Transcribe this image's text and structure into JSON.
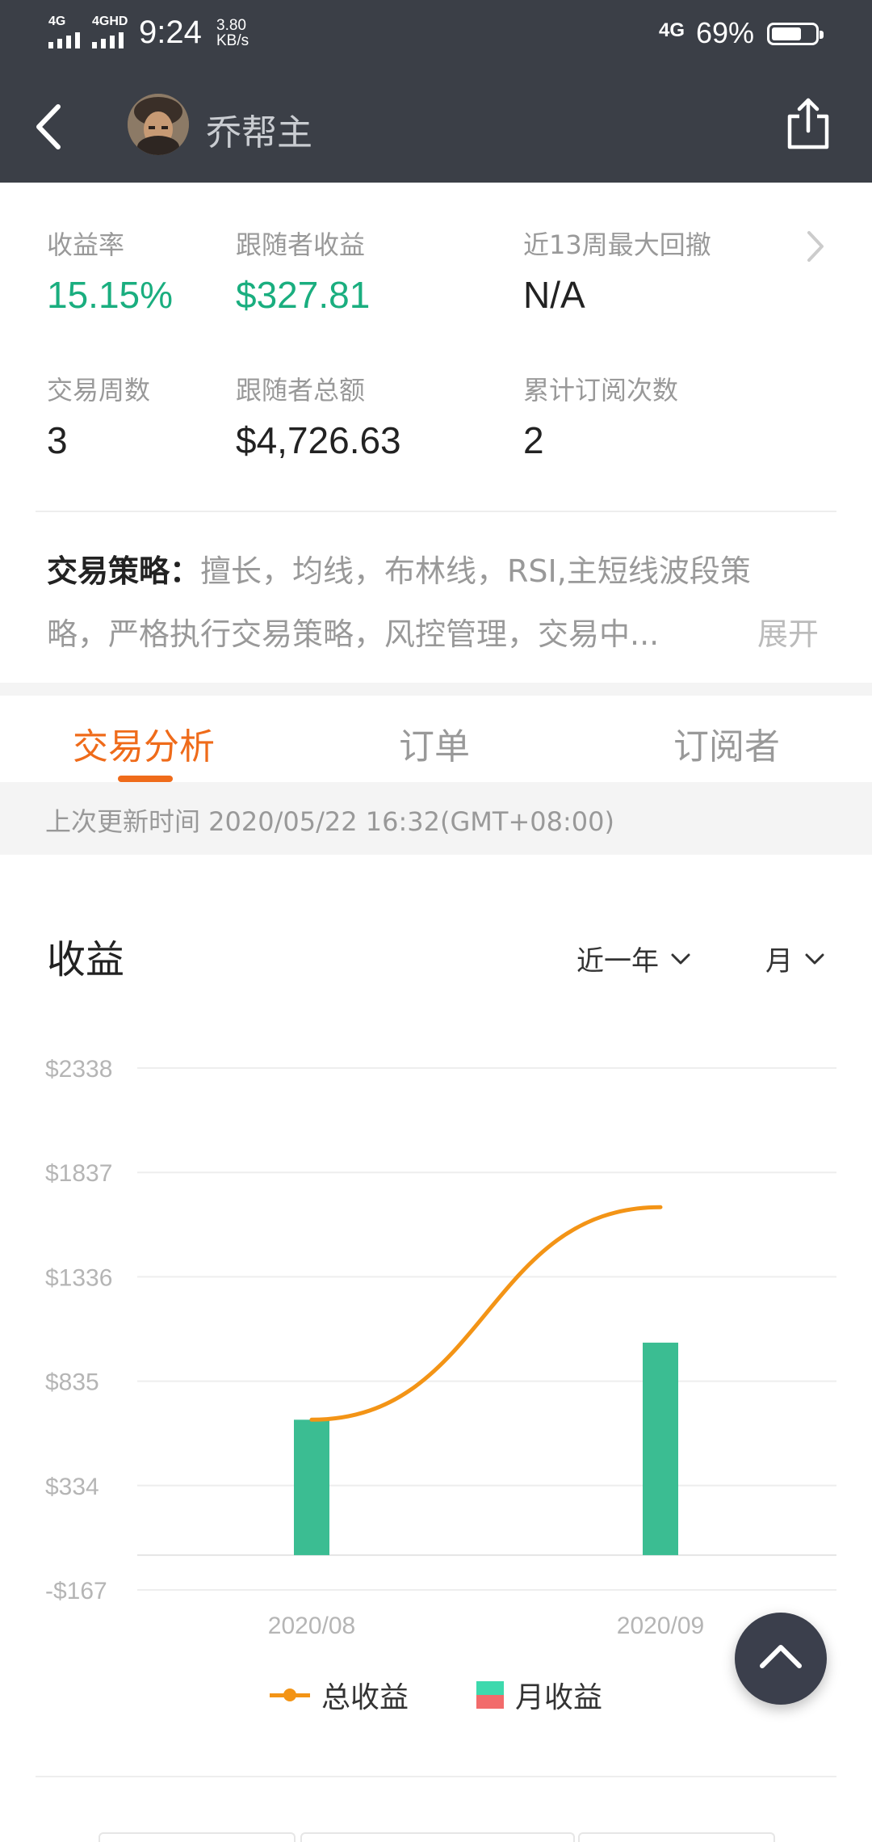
{
  "status_bar": {
    "signal1": "4G",
    "signal2": "4GHD",
    "time": "9:24",
    "speed_value": "3.80",
    "speed_unit": "KB/s",
    "network": "4G",
    "battery": "69%",
    "battery_level": 0.69
  },
  "nav": {
    "title": "乔帮主",
    "back_icon": "chevron-left-icon",
    "share_icon": "share-icon"
  },
  "stats": [
    {
      "label": "收益率",
      "value": "15.15%",
      "color": "#1aae7f"
    },
    {
      "label": "跟随者收益",
      "value": "$327.81",
      "color": "#1aae7f"
    },
    {
      "label": "近13周最大回撤",
      "value": "N/A",
      "color": "#222222"
    },
    {
      "label": "交易周数",
      "value": "3",
      "color": "#222222"
    },
    {
      "label": "跟随者总额",
      "value": "$4,726.63",
      "color": "#222222"
    },
    {
      "label": "累计订阅次数",
      "value": "2",
      "color": "#222222"
    }
  ],
  "strategy": {
    "label": "交易策略：",
    "text_line1": "擅长，均线，布林线，RSI,主短线波段策",
    "text_line2": "略，严格执行交易策略，风控管理，交易中...",
    "expand": "展开"
  },
  "tabs": [
    {
      "label": "交易分析",
      "active": true
    },
    {
      "label": "订单",
      "active": false
    },
    {
      "label": "订阅者",
      "active": false
    }
  ],
  "update_time": "上次更新时间 2020/05/22 16:32(GMT+08:00)",
  "chart_section": {
    "title": "收益",
    "range_filter": "近一年",
    "period_filter": "月"
  },
  "chart_data": {
    "type": "bar",
    "title": "收益",
    "categories": [
      "2020/08",
      "2020/09"
    ],
    "y_ticks": [
      "$2338",
      "$1837",
      "$1336",
      "$835",
      "$334",
      "-$167"
    ],
    "ylim": [
      -167,
      2338
    ],
    "grid": true,
    "series": [
      {
        "name": "月收益",
        "type": "bar",
        "values": [
          650,
          1020
        ],
        "color": "#3bbd92"
      },
      {
        "name": "总收益",
        "type": "line",
        "values": [
          650,
          1670
        ],
        "color": "#f39416"
      }
    ],
    "legend": [
      {
        "name": "总收益",
        "color": "#f39416"
      },
      {
        "name": "月收益",
        "colors": [
          "#3dd9ad",
          "#f26b6b"
        ]
      }
    ],
    "legend_position": "bottom"
  },
  "fab_icon": "chevron-up-icon",
  "colors": {
    "header_bg": "#3b3f47",
    "accent": "#ef6b1a",
    "positive": "#1aae7f"
  }
}
